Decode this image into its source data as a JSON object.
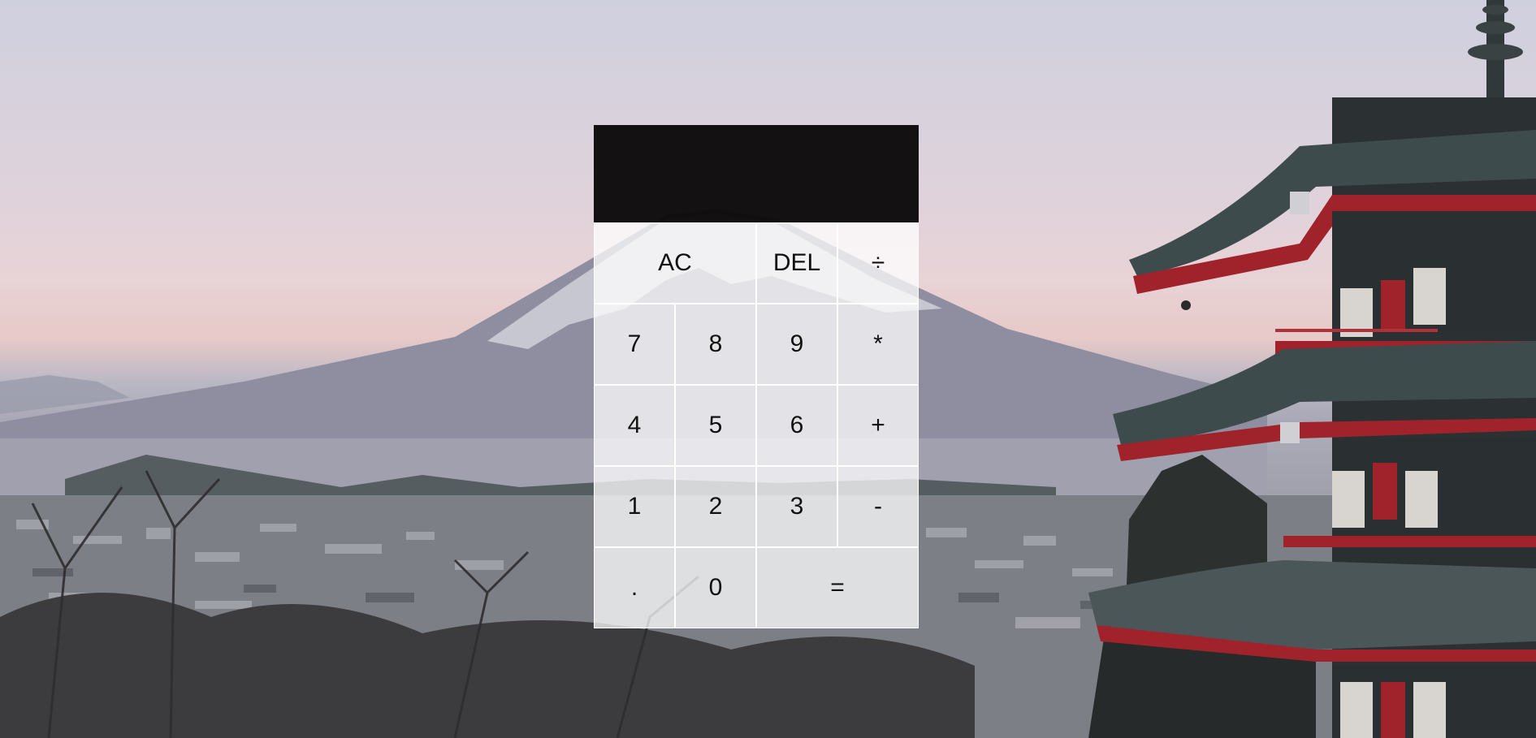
{
  "display": {
    "previous_operand": "",
    "current_operand": ""
  },
  "keys": {
    "all_clear": "AC",
    "delete": "DEL",
    "divide": "÷",
    "seven": "7",
    "eight": "8",
    "nine": "9",
    "multiply": "*",
    "four": "4",
    "five": "5",
    "six": "6",
    "add": "+",
    "one": "1",
    "two": "2",
    "three": "3",
    "subtract": "-",
    "decimal": ".",
    "zero": "0",
    "equals": "="
  },
  "colors": {
    "display_background": "#0a0808",
    "button_background": "rgba(255,255,255,0.75)",
    "button_border": "#ffffff",
    "button_text": "#111111"
  },
  "background": {
    "scene": "photo of a snow-capped mountain behind a hazy city with a red pagoda on the right"
  }
}
